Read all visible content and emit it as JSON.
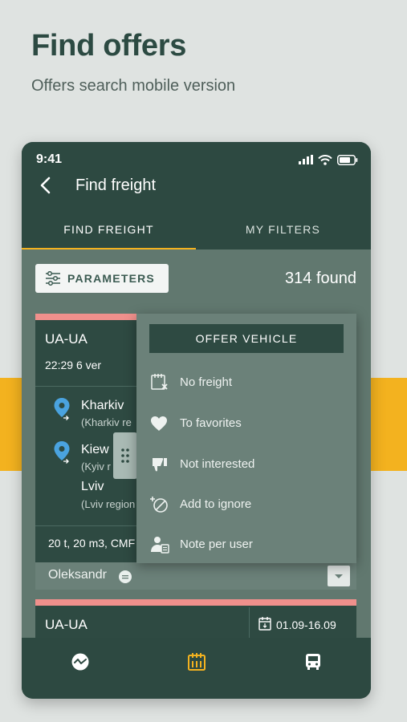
{
  "hero": {
    "title": "Find offers",
    "subtitle": "Offers search mobile version"
  },
  "status": {
    "time": "9:41",
    "icons": [
      "signal-icon",
      "wifi-icon",
      "battery-icon"
    ]
  },
  "header": {
    "title": "Find freight",
    "tabs": [
      {
        "label": "FIND FREIGHT",
        "active": true
      },
      {
        "label": "MY FILTERS",
        "active": false
      }
    ]
  },
  "toolbar": {
    "parameters_label": "PARAMETERS",
    "found_text": "314 found"
  },
  "offers": [
    {
      "route": "UA-UA",
      "time": "22:29",
      "date_fragment": "6 ver",
      "stops": [
        {
          "city": "Kharkiv",
          "region": "(Kharkiv re"
        },
        {
          "city": "Kiew",
          "region": "(Kyiv r"
        },
        {
          "city": "Lviv",
          "region": "(Lviv region"
        }
      ],
      "cargo": "20 t, 20 m3, CMF",
      "contact": "Oleksandr"
    },
    {
      "route": "UA-UA",
      "dates": "01.09-16.09"
    }
  ],
  "context_menu": {
    "primary_action": "OFFER VEHICLE",
    "items": [
      {
        "label": "No freight",
        "icon": "calendar-x-icon"
      },
      {
        "label": "To favorites",
        "icon": "heart-icon"
      },
      {
        "label": "Not interested",
        "icon": "thumbs-down-icon"
      },
      {
        "label": "Add to ignore",
        "icon": "block-icon"
      },
      {
        "label": "Note per user",
        "icon": "user-note-icon"
      }
    ]
  },
  "bottom_nav": [
    {
      "icon": "activity-icon",
      "active": false
    },
    {
      "icon": "calendar-icon",
      "active": true
    },
    {
      "icon": "truck-icon",
      "active": false
    }
  ],
  "colors": {
    "accent": "#f3b21f",
    "primary_dark": "#2d4941",
    "card_stripe": "#f0908c",
    "menu_bg": "#6b8179"
  }
}
